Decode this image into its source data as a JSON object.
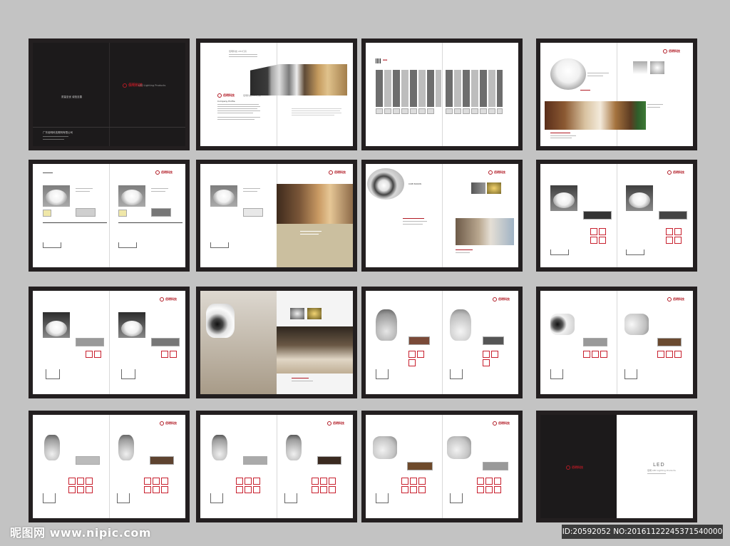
{
  "brand": {
    "logo_text": "佰明科技",
    "cover_sub": "LED Lighting Products",
    "cover_slogan": "质量至优  诚信至善",
    "company": "广东佰明科技照明有限公司"
  },
  "profile": {
    "heading": "Company Profile",
    "header_tag": "佰明科技 LED灯具"
  },
  "back_cover": {
    "title": "LED",
    "sub": "佰明 LED Lighting Products"
  },
  "spreads": [
    {
      "id": 1,
      "kind": "front-cover"
    },
    {
      "id": 2,
      "kind": "company-profile"
    },
    {
      "id": 3,
      "kind": "product-index"
    },
    {
      "id": 4,
      "kind": "downlight-intro"
    },
    {
      "id": 5,
      "kind": "downlight-products"
    },
    {
      "id": 6,
      "kind": "downlight-scene"
    },
    {
      "id": 7,
      "kind": "cob-intro"
    },
    {
      "id": 8,
      "kind": "downlight-products"
    },
    {
      "id": 9,
      "kind": "downlight-products"
    },
    {
      "id": 10,
      "kind": "spotlight-intro"
    },
    {
      "id": 11,
      "kind": "track-products"
    },
    {
      "id": 12,
      "kind": "track-products"
    },
    {
      "id": 13,
      "kind": "track-products"
    },
    {
      "id": 14,
      "kind": "track-products"
    },
    {
      "id": 15,
      "kind": "track-products"
    },
    {
      "id": 16,
      "kind": "back-cover"
    }
  ],
  "footer": {
    "watermark": "昵图网 www.nipic.com",
    "image_id": "ID:20592052 NO:20161122245371540000"
  },
  "colors": {
    "background": "#c3c3c3",
    "frame": "#231f20",
    "accent": "#b11a24"
  }
}
